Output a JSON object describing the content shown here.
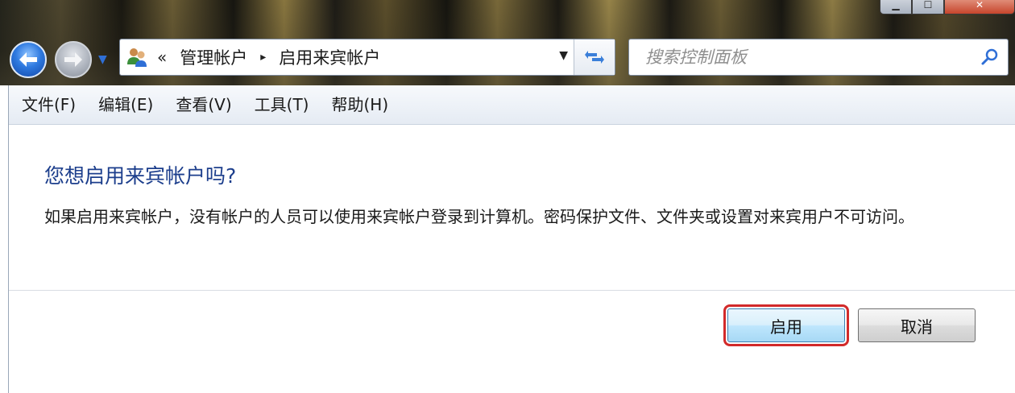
{
  "window": {
    "caption_buttons": [
      "minimize",
      "maximize",
      "close"
    ]
  },
  "navigation": {
    "address": {
      "chevron": "«",
      "crumbs": [
        "管理帐户",
        "启用来宾帐户"
      ],
      "separator": "▸"
    },
    "search": {
      "placeholder": "搜索控制面板"
    }
  },
  "menu": [
    "文件(F)",
    "编辑(E)",
    "查看(V)",
    "工具(T)",
    "帮助(H)"
  ],
  "content": {
    "title": "您想启用来宾帐户吗?",
    "description": "如果启用来宾帐户，没有帐户的人员可以使用来宾帐户登录到计算机。密码保护文件、文件夹或设置对来宾用户不可访问。"
  },
  "buttons": {
    "enable": "启用",
    "cancel": "取消"
  },
  "colors": {
    "title": "#1c3e8c",
    "highlight": "#d22a2a"
  },
  "icons": [
    "back-arrow-icon",
    "forward-arrow-icon",
    "users-icon",
    "refresh-icon",
    "search-icon"
  ]
}
